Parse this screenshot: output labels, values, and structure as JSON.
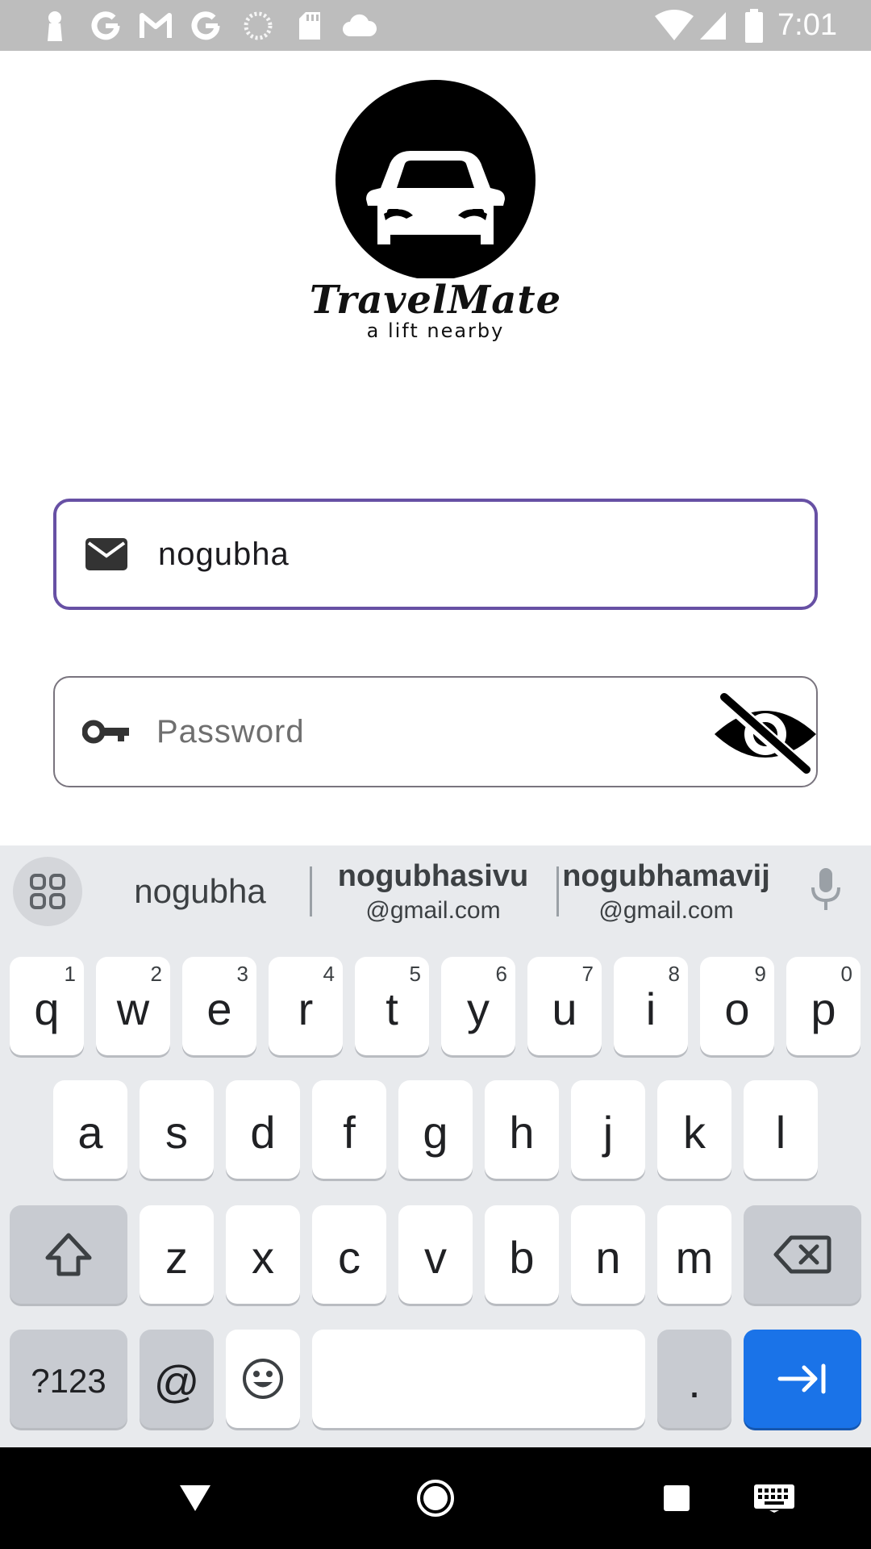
{
  "status_bar": {
    "time": "7:01",
    "left_icons": [
      "keyhole-icon",
      "google-icon",
      "gmail-icon",
      "google-icon",
      "loading-icon",
      "sd-card-icon",
      "cloud-icon"
    ],
    "right_icons": [
      "wifi-icon",
      "signal-icon",
      "battery-icon"
    ]
  },
  "brand": {
    "name": "TravelMate",
    "tagline": "a lift nearby"
  },
  "form": {
    "email": {
      "value": "nogubha",
      "icon": "mail-icon"
    },
    "password": {
      "placeholder": "Password",
      "icon": "key-icon",
      "toggle_icon": "visibility-off-icon"
    }
  },
  "keyboard": {
    "suggestions": [
      {
        "main": "nogubha",
        "sub": ""
      },
      {
        "main": "nogubhasivu",
        "sub": "@gmail.com"
      },
      {
        "main": "nogubhamavij",
        "sub": "@gmail.com"
      }
    ],
    "row1": [
      {
        "key": "q",
        "hint": "1"
      },
      {
        "key": "w",
        "hint": "2"
      },
      {
        "key": "e",
        "hint": "3"
      },
      {
        "key": "r",
        "hint": "4"
      },
      {
        "key": "t",
        "hint": "5"
      },
      {
        "key": "y",
        "hint": "6"
      },
      {
        "key": "u",
        "hint": "7"
      },
      {
        "key": "i",
        "hint": "8"
      },
      {
        "key": "o",
        "hint": "9"
      },
      {
        "key": "p",
        "hint": "0"
      }
    ],
    "row2": [
      "a",
      "s",
      "d",
      "f",
      "g",
      "h",
      "j",
      "k",
      "l"
    ],
    "row3": [
      "z",
      "x",
      "c",
      "v",
      "b",
      "n",
      "m"
    ],
    "row4": {
      "symbols": "?123",
      "at": "@",
      "period": "."
    },
    "colors": {
      "background": "#e8eaed",
      "key": "#ffffff",
      "func_key": "#c8cbd1",
      "action": "#1a73e8"
    }
  },
  "colors": {
    "focus_border": "#6750a4",
    "outline": "#79747e"
  }
}
